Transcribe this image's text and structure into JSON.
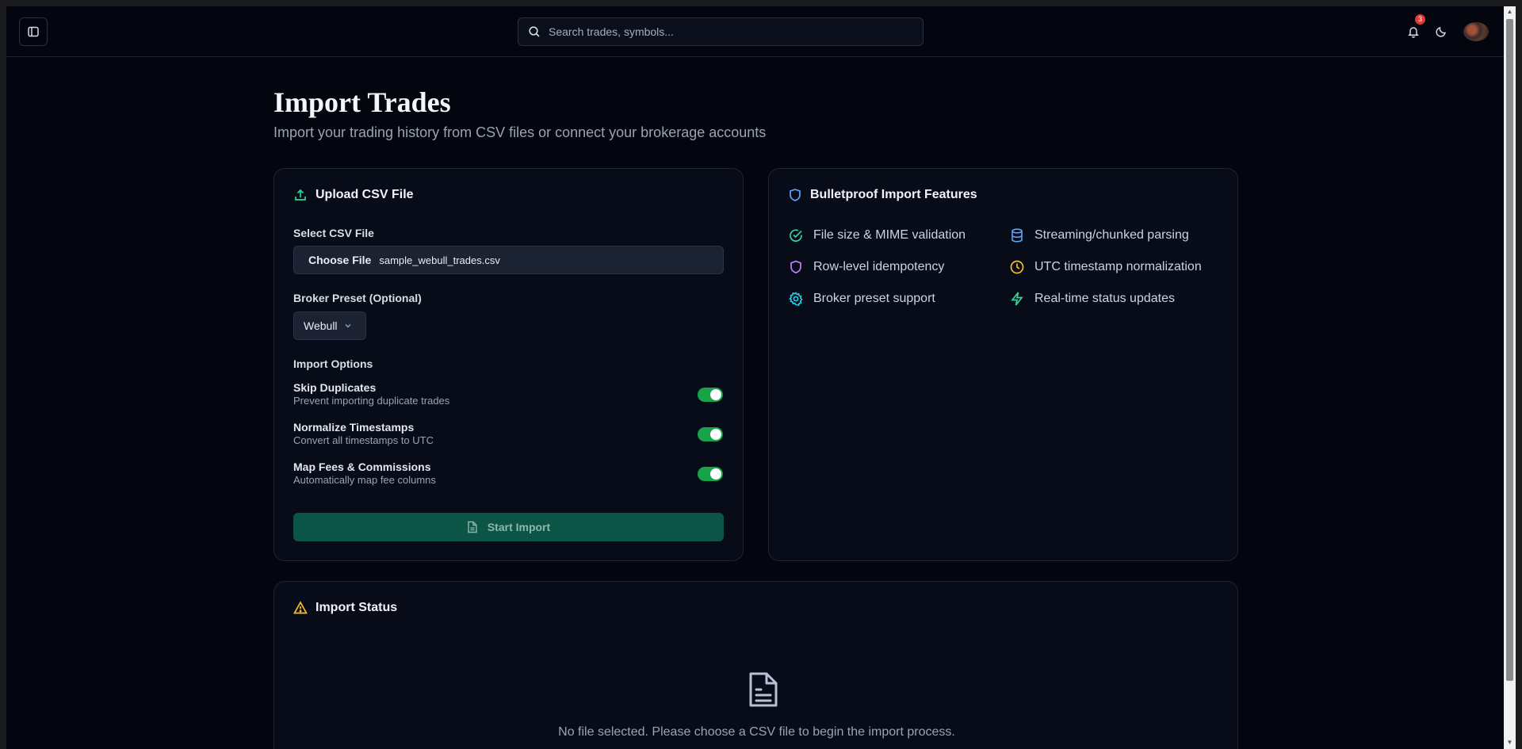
{
  "header": {
    "search_placeholder": "Search trades, symbols...",
    "notification_count": "3"
  },
  "page": {
    "title": "Import Trades",
    "subtitle": "Import your trading history from CSV files or connect your brokerage accounts"
  },
  "upload": {
    "title": "Upload CSV File",
    "select_label": "Select CSV File",
    "choose_file": "Choose File",
    "file_name": "sample_webull_trades.csv",
    "broker_label": "Broker Preset (Optional)",
    "broker_value": "Webull",
    "options_label": "Import Options",
    "options": [
      {
        "title": "Skip Duplicates",
        "desc": "Prevent importing duplicate trades",
        "enabled": true
      },
      {
        "title": "Normalize Timestamps",
        "desc": "Convert all timestamps to UTC",
        "enabled": true
      },
      {
        "title": "Map Fees & Commissions",
        "desc": "Automatically map fee columns",
        "enabled": true
      }
    ],
    "start_label": "Start Import"
  },
  "features": {
    "title": "Bulletproof Import Features",
    "items": [
      {
        "label": "File size & MIME validation",
        "icon": "check-circle-icon",
        "color": "#34d399"
      },
      {
        "label": "Streaming/chunked parsing",
        "icon": "database-icon",
        "color": "#60a5fa"
      },
      {
        "label": "Row-level idempotency",
        "icon": "shield-icon",
        "color": "#c084fc"
      },
      {
        "label": "UTC timestamp normalization",
        "icon": "clock-icon",
        "color": "#fbbf24"
      },
      {
        "label": "Broker preset support",
        "icon": "gear-icon",
        "color": "#22d3ee"
      },
      {
        "label": "Real-time status updates",
        "icon": "lightning-icon",
        "color": "#34d399"
      }
    ]
  },
  "status": {
    "title": "Import Status",
    "empty_text": "No file selected. Please choose a CSV file to begin the import process."
  },
  "colors": {
    "accent_green": "#16a34a",
    "background": "#03050f",
    "card": "#080c19"
  }
}
